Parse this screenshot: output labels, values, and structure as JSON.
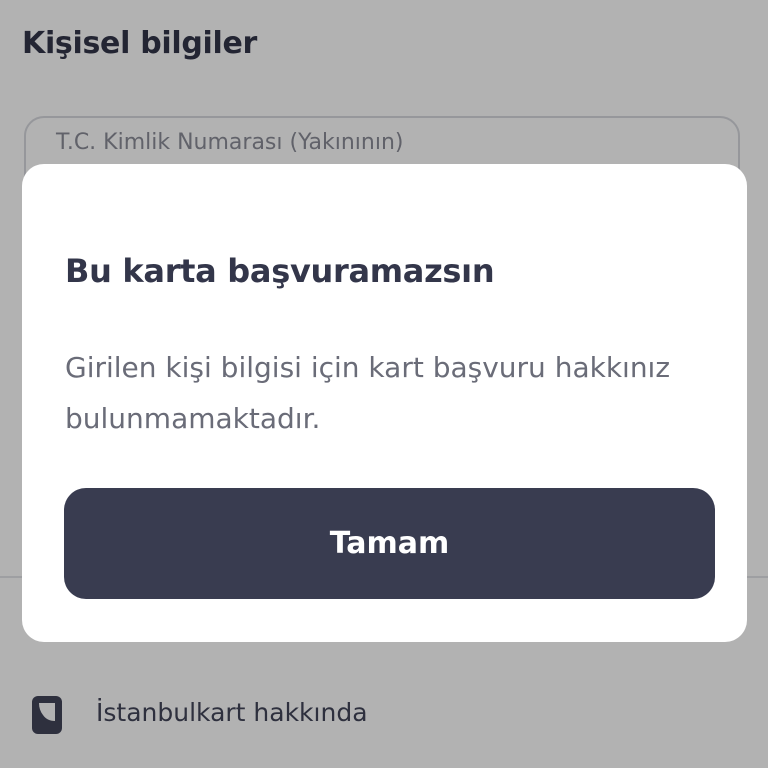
{
  "page": {
    "title": "Kişisel bilgiler"
  },
  "form": {
    "tc_field_placeholder": "T.C. Kimlik Numarası (Yakınının)"
  },
  "footer": {
    "about_label": "İstanbulkart hakkında",
    "about_icon": "card-icon"
  },
  "dialog": {
    "title": "Bu karta başvuramazsın",
    "message": "Girilen kişi bilgisi için kart başvuru hakkınız bulunmamaktadır.",
    "ok_label": "Tamam"
  },
  "colors": {
    "primary_dark": "#393c50",
    "text_dark": "#33364a",
    "text_muted": "#6a6c78",
    "overlay": "rgba(0,0,0,0.30)"
  }
}
